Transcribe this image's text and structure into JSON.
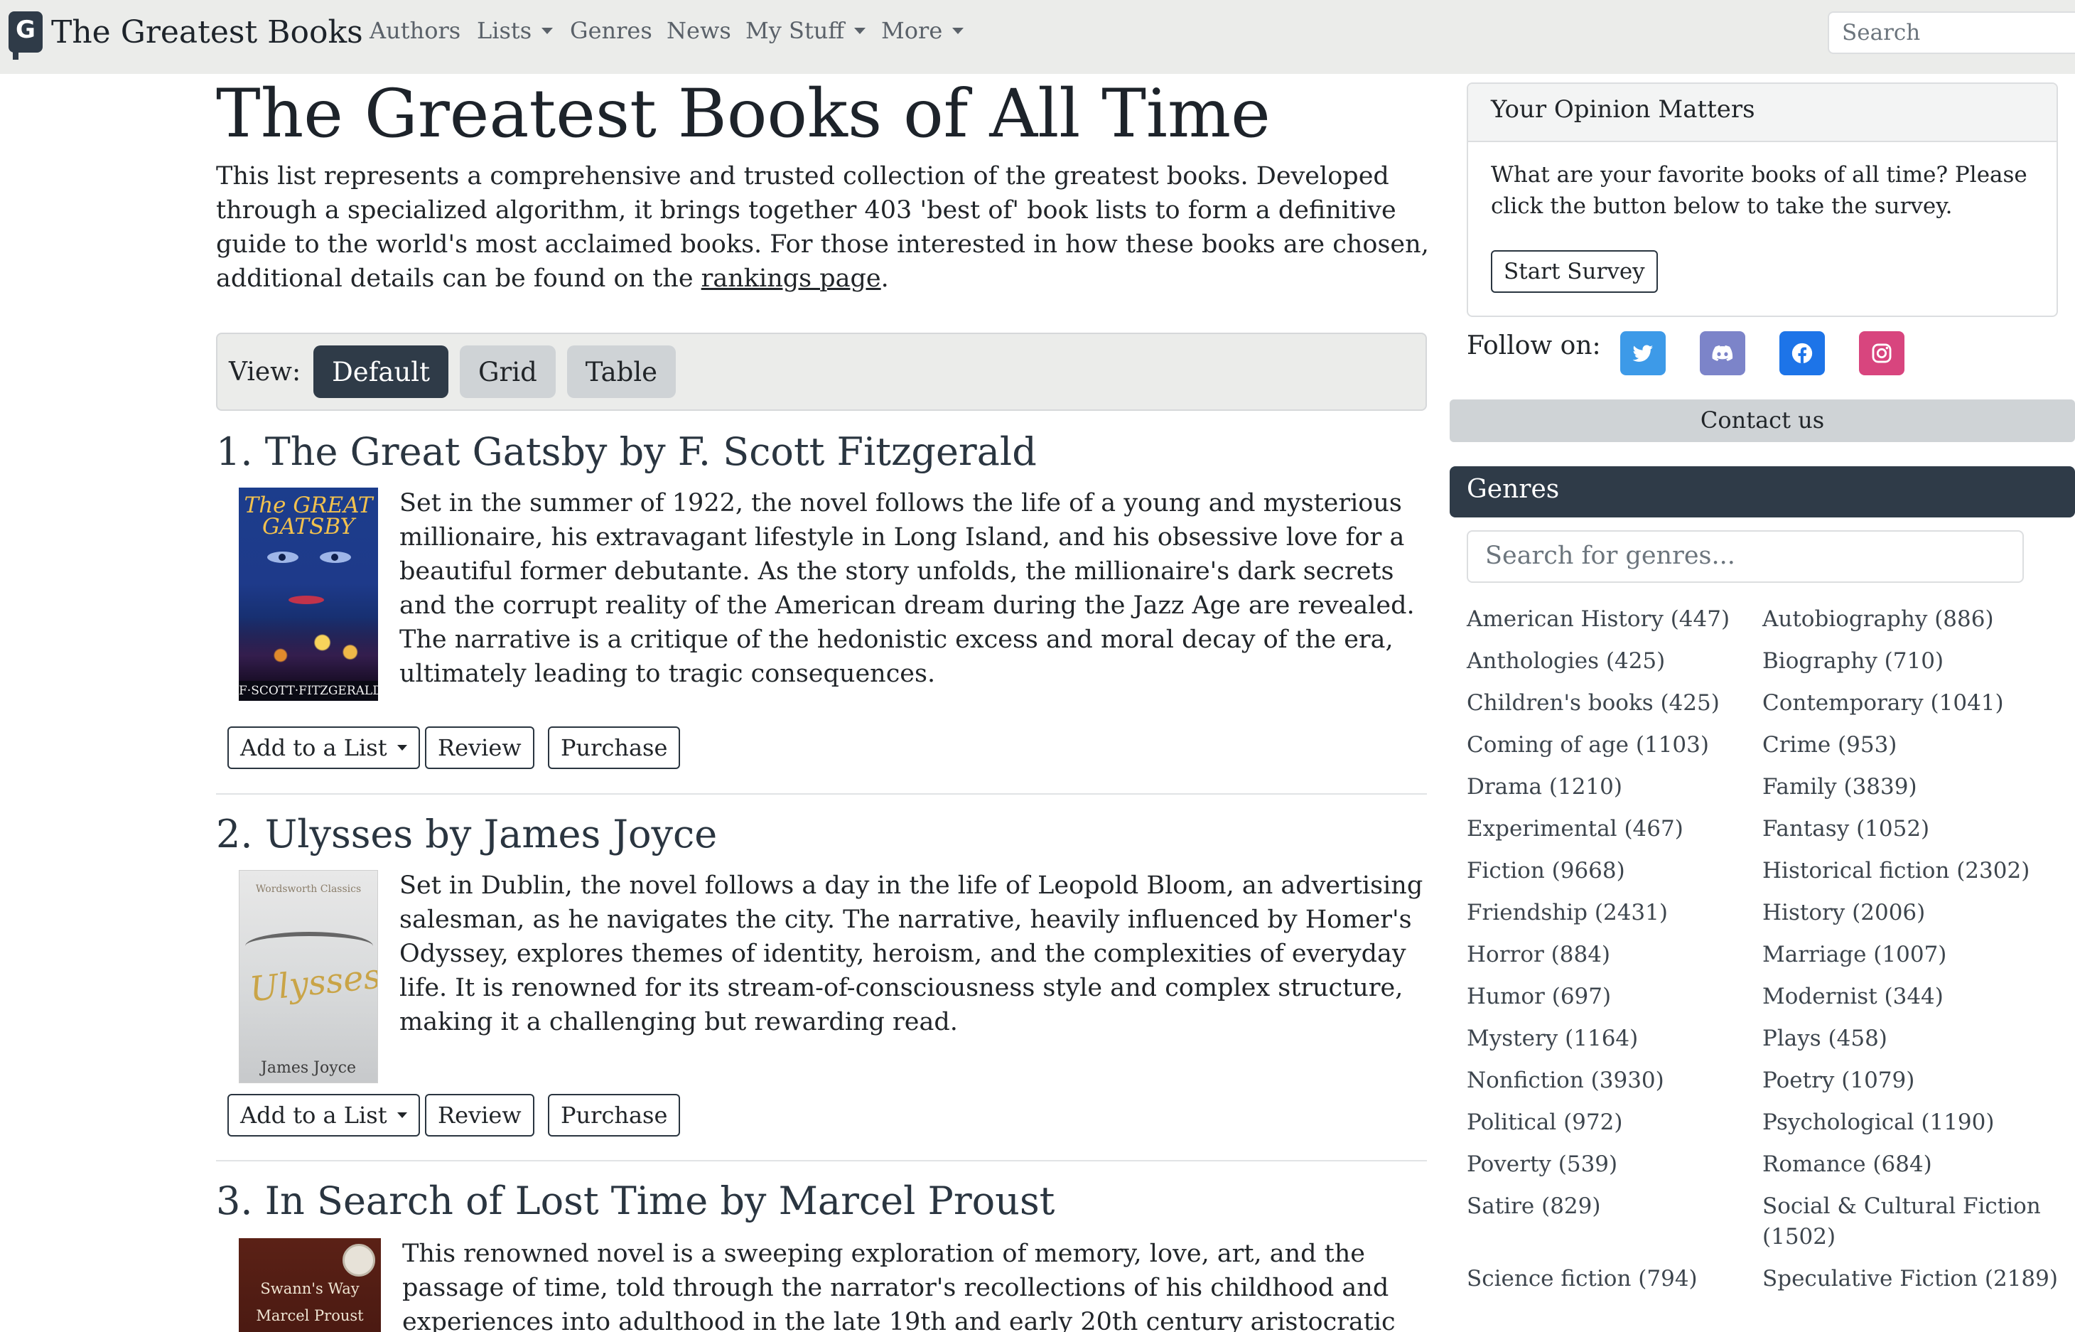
{
  "nav": {
    "brand_icon": "G",
    "brand": "The Greatest Books",
    "links": [
      "Authors",
      "Lists",
      "Genres",
      "News",
      "My Stuff",
      "More"
    ],
    "search_placeholder": "Search"
  },
  "main": {
    "title": "The Greatest Books of All Time",
    "intro": "This list represents a comprehensive and trusted collection of the greatest books. Developed through a specialized algorithm, it brings together 403 'best of' book lists to form a definitive guide to the world's most acclaimed books. For those interested in how these books are chosen, additional details can be found on the ",
    "intro_link": "rankings page",
    "intro_end": ".",
    "view_label": "View:",
    "view_buttons": [
      "Default",
      "Grid",
      "Table"
    ]
  },
  "books": [
    {
      "rank": "1.",
      "title": "The Great Gatsby by F. Scott Fitzgerald",
      "cover_title": "The GREAT GATSBY",
      "cover_author": "F·SCOTT·FITZGERALD",
      "description": "Set in the summer of 1922, the novel follows the life of a young and mysterious millionaire, his extravagant lifestyle in Long Island, and his obsessive love for a beautiful former debutante. As the story unfolds, the millionaire's dark secrets and the corrupt reality of the American dream during the Jazz Age are revealed. The narrative is a critique of the hedonistic excess and moral decay of the era, ultimately leading to tragic consequences."
    },
    {
      "rank": "2.",
      "title": "Ulysses by James Joyce",
      "cover_publisher": "Wordsworth Classics",
      "cover_title": "Ulysses",
      "cover_author": "James Joyce",
      "description": "Set in Dublin, the novel follows a day in the life of Leopold Bloom, an advertising salesman, as he navigates the city. The narrative, heavily influenced by Homer's Odyssey, explores themes of identity, heroism, and the complexities of everyday life. It is renowned for its stream-of-consciousness style and complex structure, making it a challenging but rewarding read."
    },
    {
      "rank": "3.",
      "title": "In Search of Lost Time by Marcel Proust",
      "cover_title": "Swann's Way",
      "cover_author": "Marcel Proust",
      "description": "This renowned novel is a sweeping exploration of memory, love, art, and the passage of time, told through the narrator's recollections of his childhood and experiences into adulthood in the late 19th and early 20th century aristocratic France. The narrative is"
    }
  ],
  "book_actions": {
    "add_to_list": "Add to a List",
    "review": "Review",
    "purchase": "Purchase"
  },
  "sidebar": {
    "opinion_title": "Your Opinion Matters",
    "opinion_text": "What are your favorite books of all time? Please click the button below to take the survey.",
    "survey_button": "Start Survey",
    "follow_label": "Follow on:",
    "social": [
      {
        "name": "twitter",
        "color": "#3d9ae8"
      },
      {
        "name": "discord",
        "color": "#7c84c9"
      },
      {
        "name": "facebook",
        "color": "#1d74e8"
      },
      {
        "name": "instagram",
        "color": "#d8457e"
      }
    ],
    "contact": "Contact us",
    "genres_title": "Genres",
    "genre_search_placeholder": "Search for genres...",
    "genres": [
      "American History (447)",
      "Autobiography (886)",
      "Anthologies (425)",
      "Biography (710)",
      "Children's books (425)",
      "Contemporary (1041)",
      "Coming of age (1103)",
      "Crime (953)",
      "Drama (1210)",
      "Family (3839)",
      "Experimental (467)",
      "Fantasy (1052)",
      "Fiction (9668)",
      "Historical fiction (2302)",
      "Friendship (2431)",
      "History (2006)",
      "Horror (884)",
      "Marriage (1007)",
      "Humor (697)",
      "Modernist (344)",
      "Mystery (1164)",
      "Plays (458)",
      "Nonfiction (3930)",
      "Poetry (1079)",
      "Political (972)",
      "Psychological (1190)",
      "Poverty (539)",
      "Romance (684)",
      "Satire (829)",
      "Social & Cultural Fiction (1502)",
      "Science fiction (794)",
      "Speculative Fiction (2189)"
    ]
  }
}
